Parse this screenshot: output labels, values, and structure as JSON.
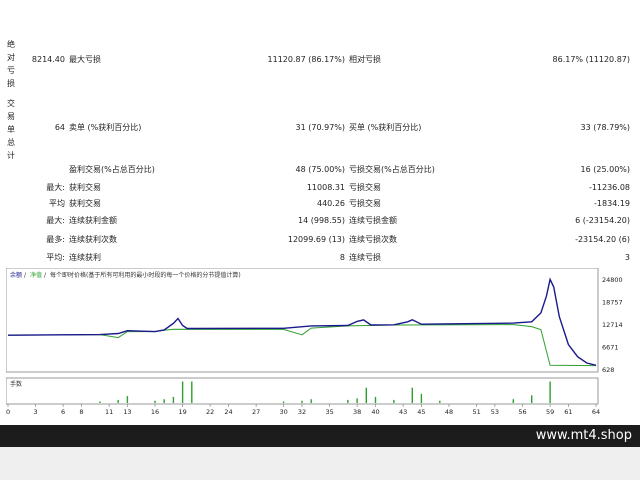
{
  "side_labels": {
    "drawdown": [
      "绝",
      "对",
      "亏",
      "损"
    ],
    "trades": [
      "交",
      "易",
      "单",
      "总",
      "计"
    ]
  },
  "drawdown_row": {
    "abs_value": "8214.40",
    "max_label": "最大亏损",
    "max_value": "11120.87 (86.17%)",
    "rel_label": "相对亏损",
    "rel_value": "86.17% (11120.87)"
  },
  "trades_row": {
    "total": "64",
    "short_label": "卖单 (%获利百分比)",
    "short_value": "31 (70.97%)",
    "long_label": "买单 (%获利百分比)",
    "long_value": "33 (78.79%)"
  },
  "stats": [
    {
      "prefix": "",
      "l1": "盈利交易(%占总百分比)",
      "v1": "48 (75.00%)",
      "l2": "亏损交易(%占总百分比)",
      "v2": "16 (25.00%)"
    },
    {
      "prefix": "最大:",
      "l1": "获利交易",
      "v1": "11008.31",
      "l2": "亏损交易",
      "v2": "-11236.08"
    },
    {
      "prefix": "平均",
      "l1": "获利交易",
      "v1": "440.26",
      "l2": "亏损交易",
      "v2": "-1834.19"
    },
    {
      "prefix": "最大:",
      "l1": "连续获利金额",
      "v1": "14 (998.55)",
      "l2": "连续亏损金额",
      "v2": "6 (-23154.20)"
    },
    {
      "prefix": "最多:",
      "l1": "连续获利次数",
      "v1": "12099.69 (13)",
      "l2": "连续亏损次数",
      "v2": "-23154.20 (6)"
    },
    {
      "prefix": "平均:",
      "l1": "连续获利",
      "v1": "8",
      "l2": "连续亏损",
      "v2": "3"
    }
  ],
  "chart_data": {
    "type": "line",
    "legend": [
      {
        "name": "余额",
        "color": "#1a1a8c"
      },
      {
        "name": "净值",
        "color": "#2ea02e"
      },
      {
        "name": "每个即时价格(基于所有可利用的最小时段的每一个价格的分节提值计算)",
        "color": "#333333"
      }
    ],
    "y_ticks": [
      24800,
      18757,
      12714,
      6671,
      628
    ],
    "ylim": [
      628,
      27000
    ],
    "x_ticks": [
      0,
      3,
      6,
      8,
      11,
      13,
      16,
      19,
      22,
      24,
      27,
      30,
      32,
      35,
      38,
      40,
      43,
      45,
      48,
      51,
      53,
      56,
      59,
      61,
      64
    ],
    "xlim": [
      0,
      64
    ],
    "balance": [
      [
        0,
        10000
      ],
      [
        10,
        10150
      ],
      [
        12,
        10450
      ],
      [
        13,
        11200
      ],
      [
        16,
        10950
      ],
      [
        17,
        11400
      ],
      [
        18,
        13200
      ],
      [
        18.5,
        14500
      ],
      [
        19,
        12600
      ],
      [
        19.5,
        11800
      ],
      [
        30,
        11850
      ],
      [
        33,
        12500
      ],
      [
        37,
        12600
      ],
      [
        38,
        13700
      ],
      [
        38.7,
        14100
      ],
      [
        39.5,
        12750
      ],
      [
        42,
        12800
      ],
      [
        43.5,
        13600
      ],
      [
        44,
        14150
      ],
      [
        45,
        12950
      ],
      [
        55,
        13250
      ],
      [
        57,
        13600
      ],
      [
        58,
        16000
      ],
      [
        58.6,
        20500
      ],
      [
        59,
        25000
      ],
      [
        59.4,
        23000
      ],
      [
        60,
        15000
      ],
      [
        61,
        7500
      ],
      [
        62,
        4200
      ],
      [
        63,
        2500
      ],
      [
        64,
        1900
      ]
    ],
    "equity": [
      [
        0,
        10000
      ],
      [
        10,
        10150
      ],
      [
        12,
        9350
      ],
      [
        13,
        11000
      ],
      [
        16,
        10950
      ],
      [
        17,
        11300
      ],
      [
        18,
        11600
      ],
      [
        30,
        11550
      ],
      [
        32,
        10100
      ],
      [
        33,
        11900
      ],
      [
        37,
        12500
      ],
      [
        42,
        12750
      ],
      [
        55,
        12850
      ],
      [
        57,
        12300
      ],
      [
        58,
        11500
      ],
      [
        59,
        1900
      ],
      [
        64,
        1800
      ]
    ],
    "volume_label": "手数",
    "volume_bars": [
      [
        10,
        2
      ],
      [
        12,
        4
      ],
      [
        13,
        9
      ],
      [
        16,
        3
      ],
      [
        17,
        5
      ],
      [
        18,
        8
      ],
      [
        19,
        28
      ],
      [
        20,
        28
      ],
      [
        30,
        2
      ],
      [
        32,
        3
      ],
      [
        33,
        5
      ],
      [
        37,
        4
      ],
      [
        38,
        6
      ],
      [
        39,
        20
      ],
      [
        40,
        8
      ],
      [
        42,
        4
      ],
      [
        44,
        20
      ],
      [
        45,
        12
      ],
      [
        47,
        3
      ],
      [
        55,
        5
      ],
      [
        57,
        10
      ],
      [
        59,
        28
      ]
    ],
    "volume_max": 30
  },
  "footer": {
    "site": "www.mt4.shop"
  }
}
